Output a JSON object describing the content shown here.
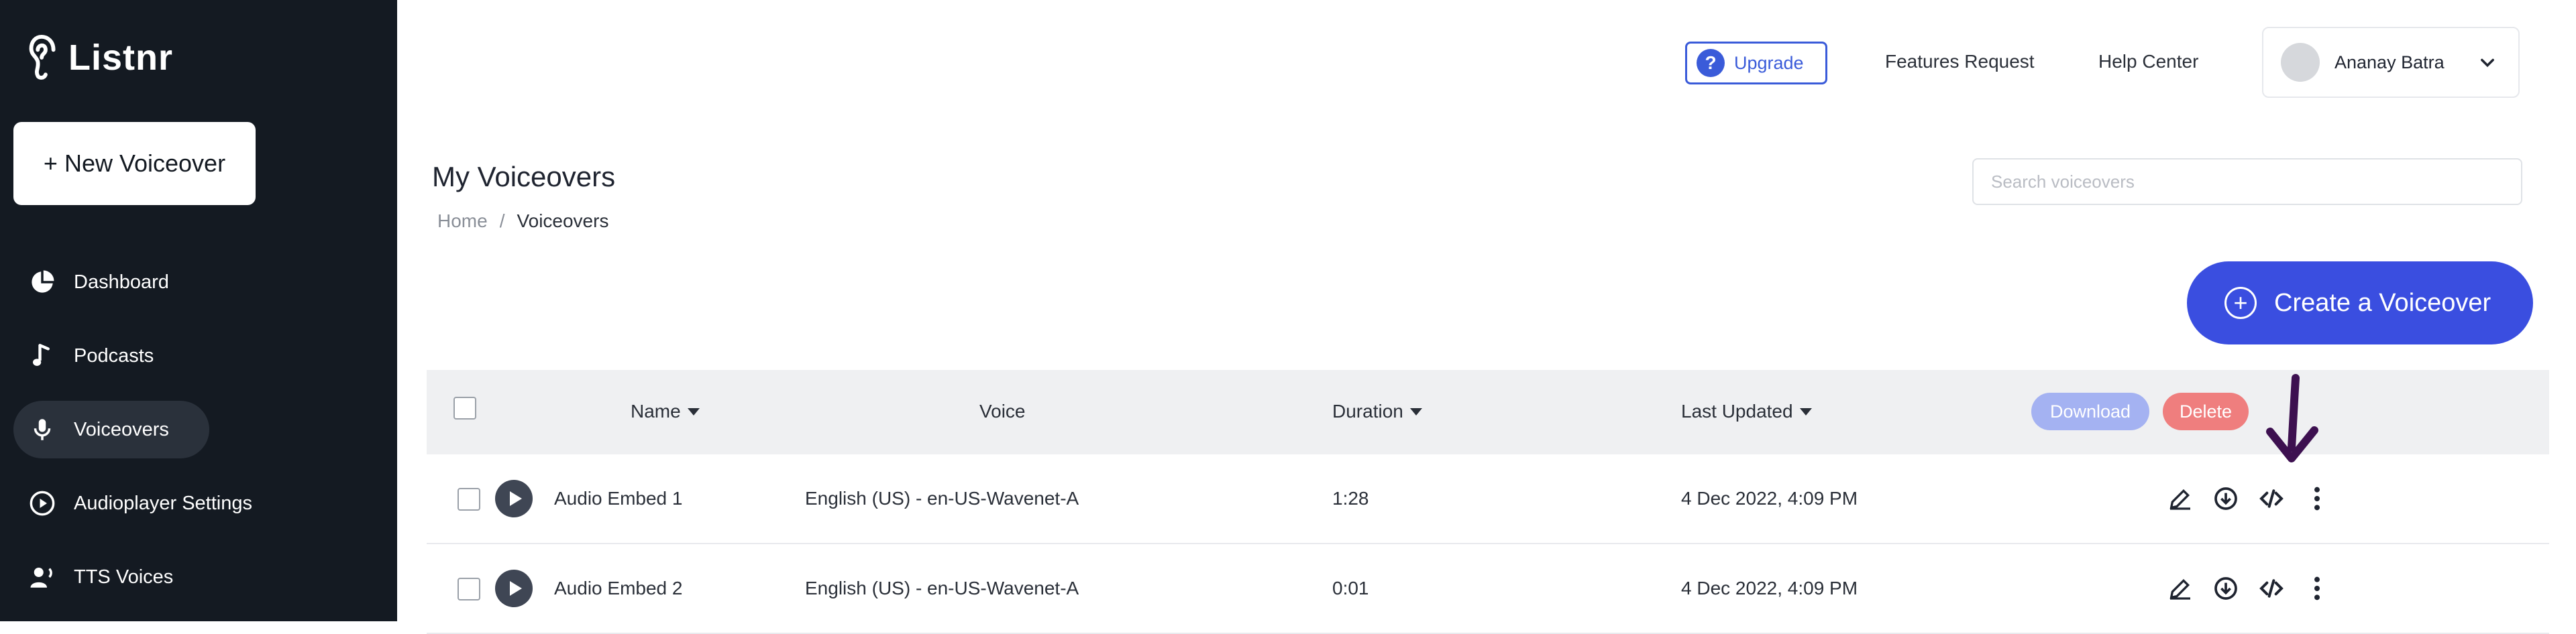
{
  "sidebar": {
    "logo_text": "Listnr",
    "new_voiceover_label": "+ New Voiceover",
    "items": [
      {
        "label": "Dashboard",
        "icon": "pie-chart-icon",
        "active": false
      },
      {
        "label": "Podcasts",
        "icon": "music-note-icon",
        "active": false
      },
      {
        "label": "Voiceovers",
        "icon": "microphone-icon",
        "active": true
      },
      {
        "label": "Audioplayer Settings",
        "icon": "play-circle-icon",
        "active": false
      },
      {
        "label": "TTS Voices",
        "icon": "voice-user-icon",
        "active": false
      }
    ]
  },
  "header": {
    "upgrade_label": "Upgrade",
    "features_request_label": "Features Request",
    "help_center_label": "Help Center",
    "user_name": "Ananay Batra"
  },
  "page": {
    "title": "My Voiceovers",
    "breadcrumb": {
      "home": "Home",
      "separator": "/",
      "current": "Voiceovers"
    },
    "search_placeholder": "Search voiceovers",
    "create_label": "Create a Voiceover"
  },
  "table": {
    "columns": {
      "name": "Name",
      "voice": "Voice",
      "duration": "Duration",
      "last_updated": "Last Updated"
    },
    "bulk_actions": {
      "download": "Download",
      "delete": "Delete"
    },
    "rows": [
      {
        "name": "Audio Embed 1",
        "voice": "English (US) - en-US-Wavenet-A",
        "duration": "1:28",
        "last_updated": "4 Dec 2022, 4:09 PM"
      },
      {
        "name": "Audio Embed 2",
        "voice": "English (US) - en-US-Wavenet-A",
        "duration": "0:01",
        "last_updated": "4 Dec 2022, 4:09 PM"
      }
    ]
  },
  "colors": {
    "sidebar_bg": "#141a22",
    "primary": "#3a4ee0",
    "download_pill": "#a4b2f2",
    "delete_pill": "#ef7e7e",
    "annotation_arrow": "#3d1050"
  }
}
